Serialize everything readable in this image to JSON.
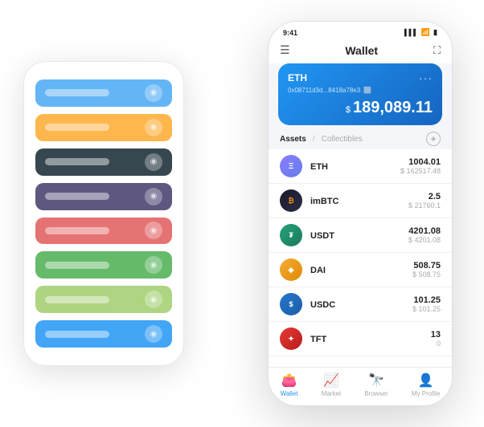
{
  "backPhone": {
    "cards": [
      {
        "color": "#64b5f6",
        "iconLabel": "◻"
      },
      {
        "color": "#ffb74d",
        "iconLabel": "◻"
      },
      {
        "color": "#37474f",
        "iconLabel": "◻"
      },
      {
        "color": "#5e5880",
        "iconLabel": "◻"
      },
      {
        "color": "#e57373",
        "iconLabel": "◻"
      },
      {
        "color": "#66bb6a",
        "iconLabel": "◻"
      },
      {
        "color": "#aed581",
        "iconLabel": "◻"
      },
      {
        "color": "#42a5f5",
        "iconLabel": "◻"
      }
    ]
  },
  "frontPhone": {
    "statusBar": {
      "time": "9:41",
      "signal": "▌▌▌",
      "wifi": "WiFi",
      "battery": "🔋"
    },
    "header": {
      "menuIcon": "☰",
      "title": "Wallet",
      "expandIcon": "⛶"
    },
    "ethCard": {
      "label": "ETH",
      "dots": "···",
      "address": "0x08711d3d...8418a78e3",
      "copyIcon": "⬜",
      "currencySymbol": "$",
      "balance": "189,089.11"
    },
    "assetsSection": {
      "tabActive": "Assets",
      "separator": "/",
      "tabInactive": "Collectibles",
      "addIcon": "+"
    },
    "assets": [
      {
        "name": "ETH",
        "logo": "Ξ",
        "logoClass": "eth-logo-circle",
        "balance": "1004.01",
        "usd": "$ 162517.48"
      },
      {
        "name": "imBTC",
        "logo": "₿",
        "logoClass": "imbtc-logo",
        "balance": "2.5",
        "usd": "$ 21760.1"
      },
      {
        "name": "USDT",
        "logo": "₮",
        "logoClass": "usdt-logo",
        "balance": "4201.08",
        "usd": "$ 4201.08"
      },
      {
        "name": "DAI",
        "logo": "◈",
        "logoClass": "dai-logo",
        "balance": "508.75",
        "usd": "$ 508.75"
      },
      {
        "name": "USDC",
        "logo": "$",
        "logoClass": "usdc-logo",
        "balance": "101.25",
        "usd": "$ 101.25"
      },
      {
        "name": "TFT",
        "logo": "✦",
        "logoClass": "tft-logo",
        "balance": "13",
        "usd": "0"
      }
    ],
    "bottomNav": [
      {
        "icon": "👛",
        "label": "Wallet",
        "active": true
      },
      {
        "icon": "📈",
        "label": "Market",
        "active": false
      },
      {
        "icon": "🔭",
        "label": "Browser",
        "active": false
      },
      {
        "icon": "👤",
        "label": "My Profile",
        "active": false
      }
    ]
  }
}
